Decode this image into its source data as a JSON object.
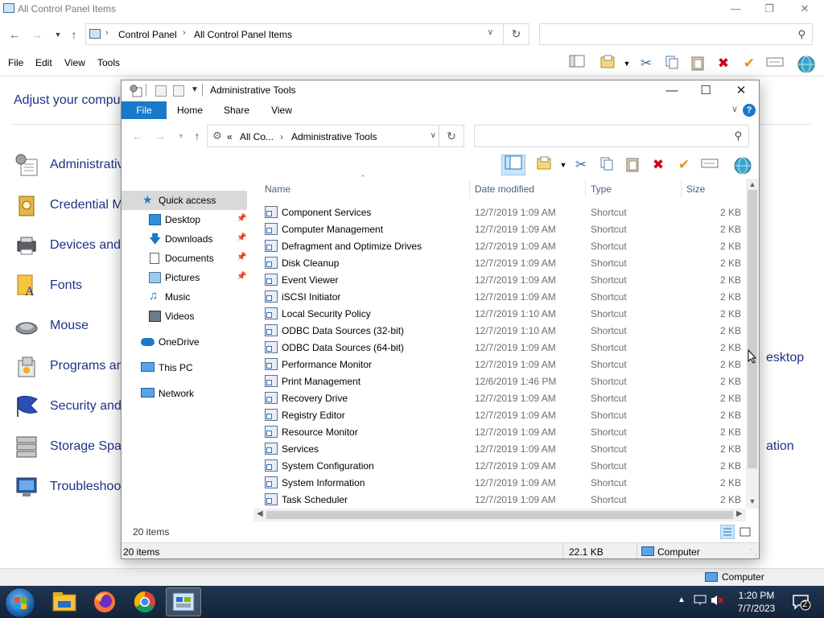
{
  "background_window": {
    "title": "All Control Panel Items",
    "address": {
      "segments": [
        "Control Panel",
        "All Control Panel Items"
      ]
    },
    "menu": [
      "File",
      "Edit",
      "View",
      "Tools"
    ],
    "heading": "Adjust your compu",
    "items": [
      {
        "label": "Administrativ",
        "icon": "admin-tools-icon"
      },
      {
        "label": "Credential M",
        "icon": "credential-manager-icon"
      },
      {
        "label": "Devices and",
        "icon": "devices-printers-icon"
      },
      {
        "label": "Fonts",
        "icon": "fonts-icon"
      },
      {
        "label": "Mouse",
        "icon": "mouse-icon"
      },
      {
        "label": "Programs an",
        "icon": "programs-features-icon"
      },
      {
        "label": "Security and",
        "icon": "security-maintenance-icon"
      },
      {
        "label": "Storage Spac",
        "icon": "storage-spaces-icon"
      },
      {
        "label": "Troubleshoot",
        "icon": "troubleshooting-icon"
      }
    ],
    "right_items": [
      "esktop",
      "ation"
    ],
    "status_computer": "Computer"
  },
  "explorer": {
    "title": "Administrative Tools",
    "ribbon_tabs": [
      "File",
      "Home",
      "Share",
      "View"
    ],
    "help_label": "?",
    "address": {
      "prefix": "«",
      "segments": [
        "All Co...",
        "Administrative Tools"
      ]
    },
    "nav": {
      "quick_access": "Quick access",
      "pinned": [
        "Desktop",
        "Downloads",
        "Documents",
        "Pictures"
      ],
      "unpinned": [
        "Music",
        "Videos"
      ],
      "onedrive": "OneDrive",
      "this_pc": "This PC",
      "network": "Network"
    },
    "columns": {
      "name": "Name",
      "date": "Date modified",
      "type": "Type",
      "size": "Size"
    },
    "files": [
      {
        "name": "Component Services",
        "date": "12/7/2019 1:09 AM",
        "type": "Shortcut",
        "size": "2 KB"
      },
      {
        "name": "Computer Management",
        "date": "12/7/2019 1:09 AM",
        "type": "Shortcut",
        "size": "2 KB"
      },
      {
        "name": "Defragment and Optimize Drives",
        "date": "12/7/2019 1:09 AM",
        "type": "Shortcut",
        "size": "2 KB"
      },
      {
        "name": "Disk Cleanup",
        "date": "12/7/2019 1:09 AM",
        "type": "Shortcut",
        "size": "2 KB"
      },
      {
        "name": "Event Viewer",
        "date": "12/7/2019 1:09 AM",
        "type": "Shortcut",
        "size": "2 KB"
      },
      {
        "name": "iSCSI Initiator",
        "date": "12/7/2019 1:09 AM",
        "type": "Shortcut",
        "size": "2 KB"
      },
      {
        "name": "Local Security Policy",
        "date": "12/7/2019 1:10 AM",
        "type": "Shortcut",
        "size": "2 KB"
      },
      {
        "name": "ODBC Data Sources (32-bit)",
        "date": "12/7/2019 1:10 AM",
        "type": "Shortcut",
        "size": "2 KB"
      },
      {
        "name": "ODBC Data Sources (64-bit)",
        "date": "12/7/2019 1:09 AM",
        "type": "Shortcut",
        "size": "2 KB"
      },
      {
        "name": "Performance Monitor",
        "date": "12/7/2019 1:09 AM",
        "type": "Shortcut",
        "size": "2 KB"
      },
      {
        "name": "Print Management",
        "date": "12/6/2019 1:46 PM",
        "type": "Shortcut",
        "size": "2 KB"
      },
      {
        "name": "Recovery Drive",
        "date": "12/7/2019 1:09 AM",
        "type": "Shortcut",
        "size": "2 KB"
      },
      {
        "name": "Registry Editor",
        "date": "12/7/2019 1:09 AM",
        "type": "Shortcut",
        "size": "2 KB"
      },
      {
        "name": "Resource Monitor",
        "date": "12/7/2019 1:09 AM",
        "type": "Shortcut",
        "size": "2 KB"
      },
      {
        "name": "Services",
        "date": "12/7/2019 1:09 AM",
        "type": "Shortcut",
        "size": "2 KB"
      },
      {
        "name": "System Configuration",
        "date": "12/7/2019 1:09 AM",
        "type": "Shortcut",
        "size": "2 KB"
      },
      {
        "name": "System Information",
        "date": "12/7/2019 1:09 AM",
        "type": "Shortcut",
        "size": "2 KB"
      },
      {
        "name": "Task Scheduler",
        "date": "12/7/2019 1:09 AM",
        "type": "Shortcut",
        "size": "2 KB"
      }
    ],
    "item_count": "20 items",
    "status": {
      "count": "20 items",
      "size": "22.1 KB",
      "location": "Computer"
    }
  },
  "taskbar": {
    "apps": [
      "file-explorer-icon",
      "firefox-icon",
      "chrome-icon",
      "control-panel-icon"
    ],
    "time": "1:20 PM",
    "date": "7/7/2023",
    "notifications": "2"
  },
  "colors": {
    "accent": "#1979ca",
    "link": "#1e3287",
    "delete_red": "#d0021b",
    "check_orange": "#e8901c"
  }
}
